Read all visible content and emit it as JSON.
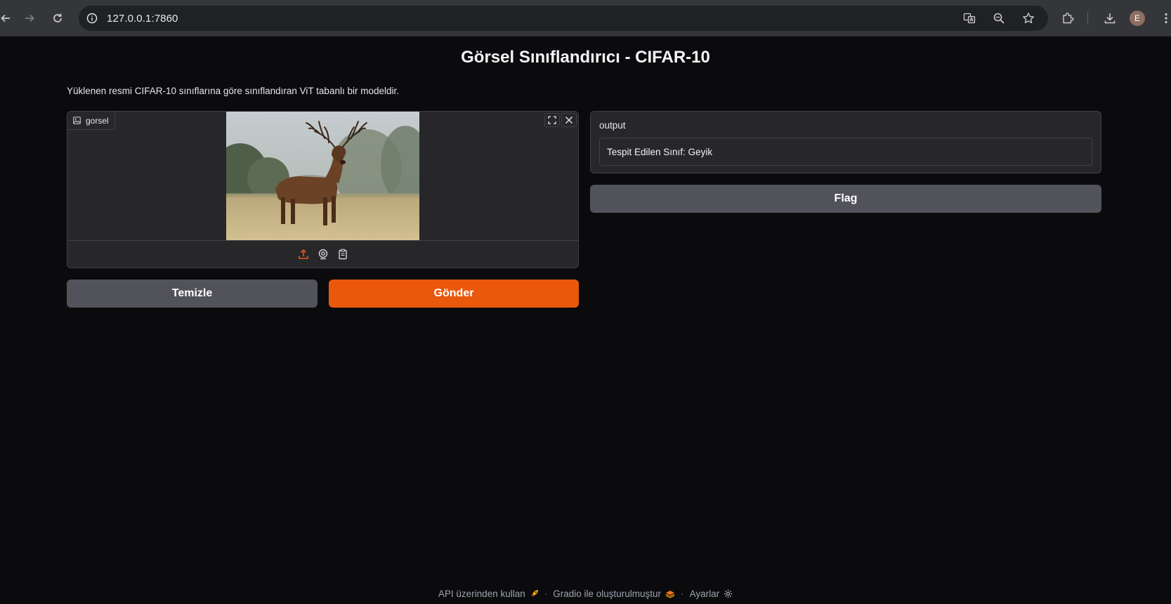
{
  "browser": {
    "url": "127.0.0.1:7860",
    "avatar_letter": "E"
  },
  "app": {
    "title": "Görsel Sınıflandırıcı - CIFAR-10",
    "description": "Yüklenen resmi CIFAR-10 sınıflarına göre sınıflandıran ViT tabanlı bir modeldir.",
    "image_input": {
      "label": "gorsel",
      "image_subject": "red deer stag standing in a grassy field"
    },
    "buttons": {
      "clear_label": "Temizle",
      "submit_label": "Gönder",
      "flag_label": "Flag"
    },
    "output": {
      "label": "output",
      "value": "Tespit Edilen Sınıf: Geyik"
    }
  },
  "footer": {
    "api_link": "API üzerinden kullan",
    "gradio_link": "Gradio ile oluşturulmuştur",
    "settings_link": "Ayarlar",
    "separator": "·"
  },
  "colors": {
    "accent": "#ea580c",
    "secondary_button": "#52525b",
    "panel": "#27272a",
    "background": "#0b0b0d"
  }
}
